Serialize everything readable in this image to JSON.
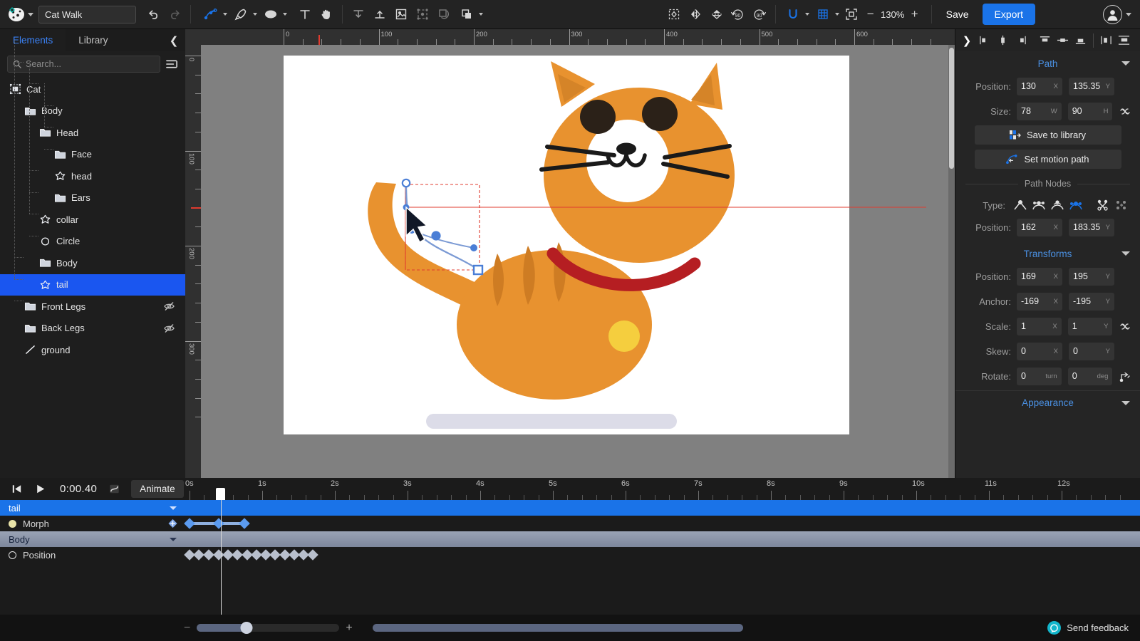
{
  "app": {
    "project_title": "Cat Walk",
    "zoom_level": "130%",
    "save_label": "Save",
    "export_label": "Export"
  },
  "toolbar": {
    "icons": [
      {
        "name": "app-logo",
        "label": "logo"
      },
      {
        "name": "undo-icon",
        "label": "Undo"
      },
      {
        "name": "redo-icon",
        "label": "Redo"
      },
      {
        "name": "node-tool-icon",
        "label": "Node tool"
      },
      {
        "name": "pen-tool-icon",
        "label": "Pen tool"
      },
      {
        "name": "shape-tool-icon",
        "label": "Shape tool"
      },
      {
        "name": "text-tool-icon",
        "label": "Text"
      },
      {
        "name": "hand-tool-icon",
        "label": "Pan"
      },
      {
        "name": "align-top-icon",
        "label": "Align top"
      },
      {
        "name": "align-bottom-icon",
        "label": "Align bottom"
      },
      {
        "name": "group-icon",
        "label": "Group"
      },
      {
        "name": "ungroup-icon",
        "label": "Ungroup"
      },
      {
        "name": "mask-icon",
        "label": "Mask"
      },
      {
        "name": "boolean-icon",
        "label": "Boolean"
      },
      {
        "name": "fit-selection-icon",
        "label": "Fit selection"
      },
      {
        "name": "flip-horizontal-icon",
        "label": "Flip horizontal"
      },
      {
        "name": "flip-vertical-icon",
        "label": "Flip vertical"
      },
      {
        "name": "rotate-ccw-90-icon",
        "label": "90"
      },
      {
        "name": "rotate-cw-90-icon",
        "label": "90"
      },
      {
        "name": "snap-magnet-icon",
        "label": "Snapping"
      },
      {
        "name": "grid-icon",
        "label": "Grid"
      },
      {
        "name": "fit-to-screen-icon",
        "label": "Fit to screen"
      }
    ],
    "rotate_ccw_label": "90",
    "rotate_cw_label": "90",
    "zoom_out_label": "−",
    "zoom_in_label": "+"
  },
  "left_panel": {
    "tabs": [
      {
        "label": "Elements",
        "active": true
      },
      {
        "label": "Library",
        "active": false
      }
    ],
    "search_placeholder": "Search...",
    "tree": [
      {
        "label": "Cat",
        "depth": 0,
        "icon": "artboard-icon",
        "hidden": false,
        "selected": false
      },
      {
        "label": "Body",
        "depth": 1,
        "icon": "folder-open-icon",
        "hidden": false,
        "selected": false
      },
      {
        "label": "Head",
        "depth": 2,
        "icon": "folder-open-icon",
        "hidden": false,
        "selected": false
      },
      {
        "label": "Face",
        "depth": 3,
        "icon": "folder-icon",
        "hidden": false,
        "selected": false
      },
      {
        "label": "head",
        "depth": 3,
        "icon": "path-star-icon",
        "hidden": false,
        "selected": false
      },
      {
        "label": "Ears",
        "depth": 3,
        "icon": "folder-icon",
        "hidden": false,
        "selected": false
      },
      {
        "label": "collar",
        "depth": 2,
        "icon": "path-star-icon",
        "hidden": false,
        "selected": false
      },
      {
        "label": "Circle",
        "depth": 2,
        "icon": "circle-icon",
        "hidden": false,
        "selected": false
      },
      {
        "label": "Body",
        "depth": 2,
        "icon": "folder-icon",
        "hidden": false,
        "selected": false
      },
      {
        "label": "tail",
        "depth": 2,
        "icon": "path-star-icon",
        "hidden": false,
        "selected": true
      },
      {
        "label": "Front Legs",
        "depth": 1,
        "icon": "folder-icon",
        "hidden": true,
        "selected": false
      },
      {
        "label": "Back Legs",
        "depth": 1,
        "icon": "folder-open-icon",
        "hidden": true,
        "selected": false
      },
      {
        "label": "ground",
        "depth": 1,
        "icon": "line-icon",
        "hidden": false,
        "selected": false
      }
    ]
  },
  "canvas": {
    "h_ruler_labels": [
      "0",
      "100",
      "200",
      "300",
      "400",
      "500",
      "600"
    ],
    "v_ruler_labels": [
      "0",
      "100",
      "200",
      "300"
    ],
    "artboard_bg": "#ffffff",
    "cat_colors": {
      "body": "#E8922F",
      "body_shade": "#CE7C23",
      "ear_inner": "#D58428",
      "muzzle": "#FFFFFF",
      "eye": "#2B2118",
      "collar": "#B51E22",
      "bell": "#F5CE3E",
      "ground": "#DCDCE8",
      "whisker": "#1A1A1A"
    },
    "overlay_colors": {
      "selection_box": "#E03B2F",
      "path_stroke": "#7B9AD4",
      "node_fill": "#4A7ED6",
      "anchor": "#FFFFFF"
    }
  },
  "right_panel": {
    "align_icons": [
      {
        "name": "align-left-icon"
      },
      {
        "name": "align-center-h-icon"
      },
      {
        "name": "align-right-icon"
      },
      {
        "name": "align-top-icon"
      },
      {
        "name": "align-middle-v-icon"
      },
      {
        "name": "align-bottom-icon"
      },
      {
        "name": "distribute-h-icon"
      },
      {
        "name": "distribute-v-icon"
      }
    ],
    "sections": {
      "path": {
        "title": "Path",
        "position_label": "Position:",
        "position_x": "130",
        "position_y": "135.35",
        "size_label": "Size:",
        "size_w": "78",
        "size_h": "90",
        "unit_x": "X",
        "unit_y": "Y",
        "unit_w": "W",
        "unit_h": "H",
        "save_library_label": "Save to library",
        "motion_path_label": "Set motion path"
      },
      "path_nodes": {
        "title": "Path Nodes",
        "type_label": "Type:",
        "node_types": [
          {
            "name": "node-type-corner-icon",
            "active": false
          },
          {
            "name": "node-type-smooth-icon",
            "active": false
          },
          {
            "name": "node-type-symmetric-icon",
            "active": false
          },
          {
            "name": "node-type-auto-icon",
            "active": true
          }
        ],
        "extra_tools": [
          {
            "name": "break-node-icon",
            "active": false
          },
          {
            "name": "join-node-icon",
            "active": false
          }
        ],
        "position_label": "Position:",
        "position_x": "162",
        "position_y": "183.35"
      },
      "transforms": {
        "title": "Transforms",
        "position_label": "Position:",
        "position_x": "169",
        "position_y": "195",
        "anchor_label": "Anchor:",
        "anchor_x": "-169",
        "anchor_y": "-195",
        "scale_label": "Scale:",
        "scale_x": "1",
        "scale_y": "1",
        "skew_label": "Skew:",
        "skew_x": "0",
        "skew_y": "0",
        "rotate_label": "Rotate:",
        "rotate_turn": "0",
        "rotate_deg": "0",
        "unit_turn": "turn",
        "unit_deg": "deg"
      },
      "appearance": {
        "title": "Appearance"
      }
    }
  },
  "timeline": {
    "current_time": "0:00.40",
    "animate_label": "Animate",
    "controls": [
      {
        "name": "jump-to-start-button"
      },
      {
        "name": "play-button"
      },
      {
        "name": "easing-curve-button"
      }
    ],
    "ruler_labels": [
      "0s",
      "1s",
      "2s",
      "3s",
      "4s",
      "5s",
      "6s",
      "7s",
      "8s",
      "9s",
      "10s",
      "11s",
      "12s"
    ],
    "tracks": [
      {
        "label": "tail",
        "type": "group",
        "selected": true
      },
      {
        "label": "Morph",
        "type": "property",
        "marker": "morph-dot",
        "keyframes": [
          0.0,
          0.4,
          0.75
        ],
        "has_range": true
      },
      {
        "label": "Body",
        "type": "group",
        "selected": false
      },
      {
        "label": "Position",
        "type": "property",
        "marker": "position-circle",
        "keyframes": [
          0.0,
          0.13,
          0.26,
          0.4,
          0.53,
          0.66,
          0.79,
          0.92,
          1.05,
          1.18,
          1.31,
          1.44,
          1.57,
          1.7
        ],
        "has_range": false
      }
    ]
  },
  "bottom_bar": {
    "zoom_out_label": "−",
    "zoom_in_label": "+",
    "feedback_label": "Send feedback"
  }
}
